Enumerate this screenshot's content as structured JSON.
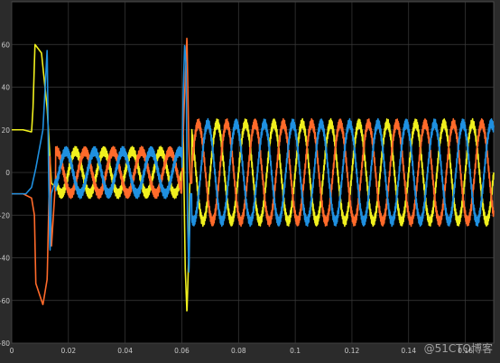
{
  "chart_data": {
    "type": "line",
    "title": "",
    "xlabel": "",
    "ylabel": "",
    "xlim": [
      0,
      0.17
    ],
    "ylim": [
      -80,
      80
    ],
    "x_ticks": [
      0,
      0.02,
      0.04,
      0.06,
      0.08,
      0.1,
      0.12,
      0.14,
      0.16
    ],
    "x_tick_labels": [
      "0",
      "0.02",
      "0.04",
      "0.06",
      "0.08",
      "0.1",
      "0.12",
      "0.14",
      "0.16"
    ],
    "y_ticks": [
      -80,
      -60,
      -40,
      -20,
      0,
      20,
      40,
      60
    ],
    "y_tick_labels": [
      "-80",
      "-60",
      "-40",
      "-20",
      "0",
      "20",
      "40",
      "60"
    ],
    "grid": true,
    "legend": "none",
    "background": "#000000",
    "frame_color": "#2b2b2b",
    "grid_color": "#3c3c3c",
    "tick_color": "#c8c8c8",
    "series": [
      {
        "color": "#f0f01e",
        "description": "phase A current",
        "points": [
          [
            0,
            20
          ],
          [
            0.004,
            20
          ],
          [
            0.007,
            19
          ],
          [
            0.0075,
            30
          ],
          [
            0.0082,
            60
          ],
          [
            0.0105,
            56
          ],
          [
            0.0125,
            30
          ],
          [
            0.014,
            -5
          ],
          [
            0.0155,
            -7
          ],
          [
            0.06,
            -7
          ],
          [
            0.0605,
            18
          ],
          [
            0.0612,
            -45
          ],
          [
            0.0618,
            -66
          ],
          [
            0.0624,
            -40
          ],
          [
            0.0628,
            -5
          ],
          [
            0.17,
            -5
          ]
        ],
        "steady": [
          {
            "from": 0.0155,
            "to": 0.06,
            "amp": 10,
            "phase": 0
          },
          {
            "from": 0.0635,
            "to": 0.17,
            "amp": 23,
            "phase": 0
          }
        ]
      },
      {
        "color": "#ff6a2a",
        "description": "phase B current",
        "points": [
          [
            0,
            -10
          ],
          [
            0.004,
            -10
          ],
          [
            0.007,
            -12
          ],
          [
            0.008,
            -20
          ],
          [
            0.0085,
            -52
          ],
          [
            0.011,
            -62
          ],
          [
            0.0125,
            -50
          ],
          [
            0.0135,
            10
          ],
          [
            0.014,
            -35
          ],
          [
            0.0155,
            -3
          ],
          [
            0.06,
            -3
          ],
          [
            0.0608,
            30
          ],
          [
            0.0618,
            64
          ],
          [
            0.0625,
            10
          ],
          [
            0.063,
            -5
          ],
          [
            0.17,
            -5
          ]
        ],
        "steady": [
          {
            "from": 0.0155,
            "to": 0.06,
            "amp": 10,
            "phase": -2.094
          },
          {
            "from": 0.0635,
            "to": 0.17,
            "amp": 23,
            "phase": -2.094
          }
        ]
      },
      {
        "color": "#1f90e0",
        "description": "phase C current",
        "points": [
          [
            0,
            -10
          ],
          [
            0.005,
            -10
          ],
          [
            0.007,
            -7
          ],
          [
            0.0085,
            2
          ],
          [
            0.011,
            20
          ],
          [
            0.0125,
            58
          ],
          [
            0.013,
            0
          ],
          [
            0.0135,
            -38
          ],
          [
            0.014,
            -10
          ],
          [
            0.0155,
            -3
          ],
          [
            0.06,
            -3
          ],
          [
            0.0605,
            38
          ],
          [
            0.061,
            60
          ],
          [
            0.0615,
            50
          ],
          [
            0.062,
            -20
          ],
          [
            0.0625,
            -48
          ],
          [
            0.063,
            -10
          ],
          [
            0.17,
            -5
          ]
        ],
        "steady": [
          {
            "from": 0.0155,
            "to": 0.06,
            "amp": 10,
            "phase": 2.094
          },
          {
            "from": 0.0635,
            "to": 0.17,
            "amp": 23,
            "phase": 2.094
          }
        ]
      }
    ],
    "fundamental_hz": 100,
    "ripple_amp": 2.2
  },
  "watermark": "@51CTO博客"
}
